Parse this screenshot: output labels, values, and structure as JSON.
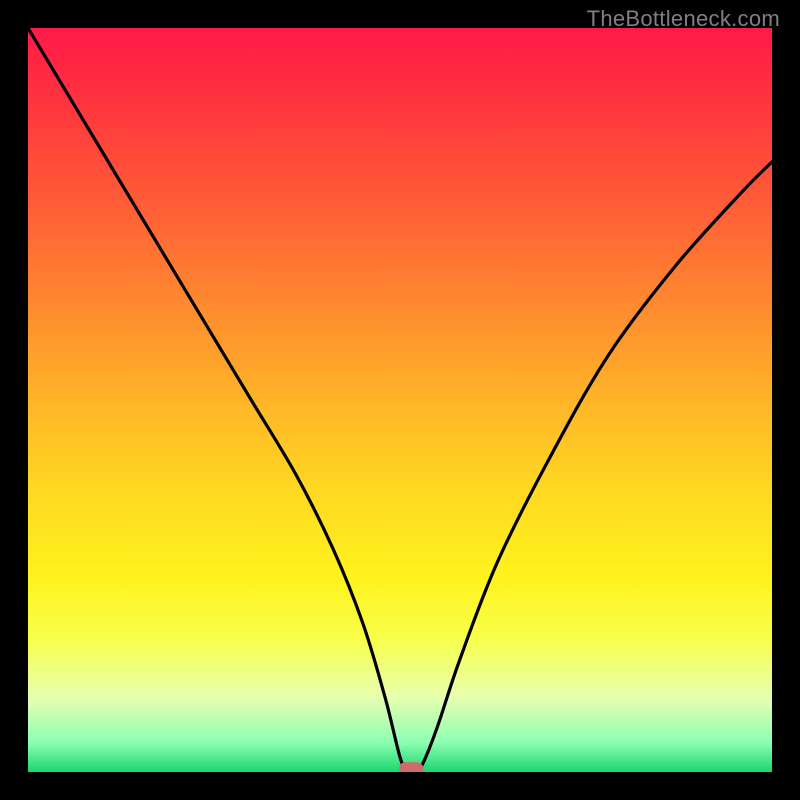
{
  "watermark": "TheBottleneck.com",
  "chart_data": {
    "type": "line",
    "title": "",
    "xlabel": "",
    "ylabel": "",
    "xlim": [
      0,
      100
    ],
    "ylim": [
      0,
      100
    ],
    "series": [
      {
        "name": "curve",
        "x": [
          0,
          6,
          12,
          18,
          24,
          30,
          36,
          41,
          45,
          48,
          50,
          51,
          52,
          53,
          55,
          58,
          63,
          70,
          78,
          87,
          96,
          100
        ],
        "values": [
          100,
          90,
          80,
          70,
          60,
          50,
          40,
          30,
          20,
          10,
          2,
          0,
          0,
          1,
          6,
          15,
          28,
          42,
          56,
          68,
          78,
          82
        ]
      }
    ],
    "marker": {
      "x": 51.5,
      "y": 0.5,
      "color": "#cf6b6b"
    },
    "gradient_stops": [
      {
        "pos": 0,
        "color": "#ff1a47"
      },
      {
        "pos": 50,
        "color": "#ffd822"
      },
      {
        "pos": 100,
        "color": "#1cd66e"
      }
    ]
  }
}
